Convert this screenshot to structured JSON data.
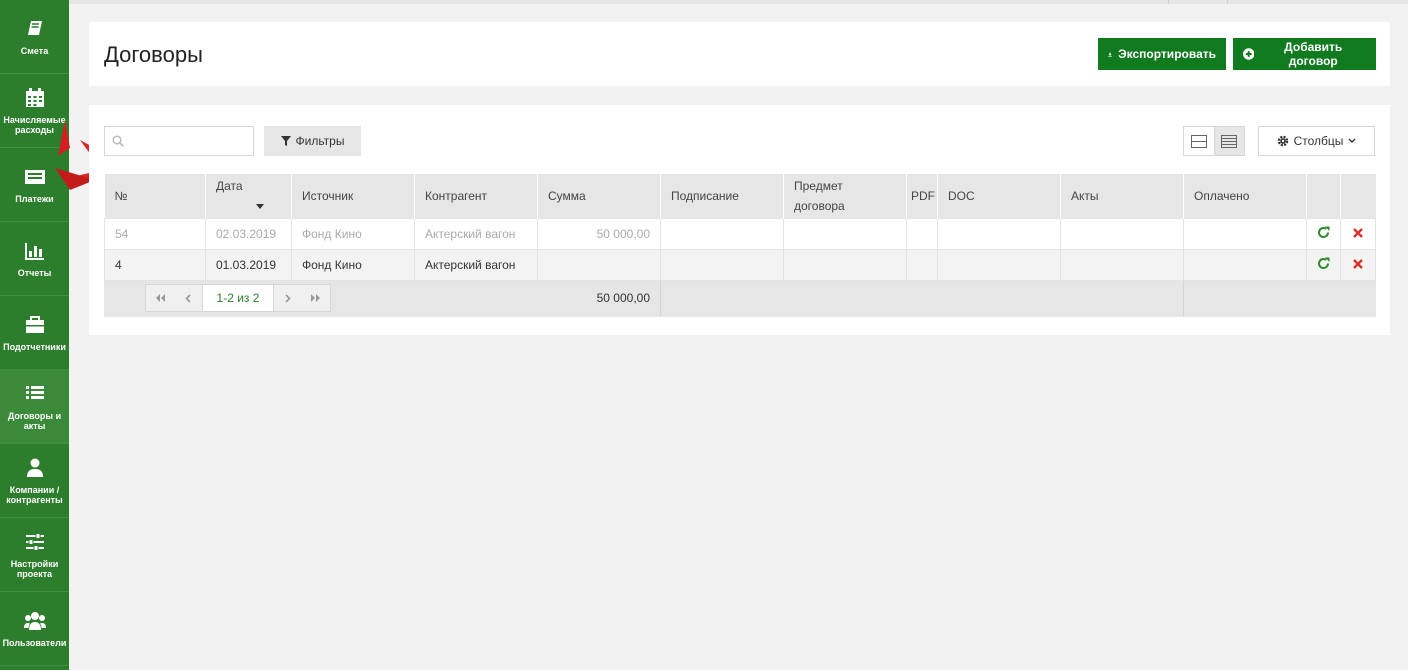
{
  "sidebar": {
    "items": [
      {
        "label": "Смета",
        "icon": "book-icon"
      },
      {
        "label": "Начисляемые расходы",
        "icon": "calendar-icon"
      },
      {
        "label": "Платежи",
        "icon": "money-icon"
      },
      {
        "label": "Отчеты",
        "icon": "bar-chart-icon"
      },
      {
        "label": "Подотчетники",
        "icon": "briefcase-icon"
      },
      {
        "label": "Договоры и акты",
        "icon": "list-icon"
      },
      {
        "label": "Компании / контрагенты",
        "icon": "user-icon"
      },
      {
        "label": "Настройки проекта",
        "icon": "sliders-icon"
      },
      {
        "label": "Пользователи",
        "icon": "users-icon"
      }
    ]
  },
  "header": {
    "title": "Договоры",
    "export_label": "Экспортировать",
    "add_label": "Добавить договор"
  },
  "toolbar": {
    "search_value": "",
    "filter_label": "Фильтры",
    "columns_label": "Столбцы"
  },
  "table": {
    "columns": [
      "№",
      "Дата",
      "Источник",
      "Контрагент",
      "Сумма",
      "Подписание",
      "Предмет договора",
      "PDF",
      "DOC",
      "Акты",
      "Оплачено"
    ],
    "rows": [
      {
        "num": "54",
        "date": "02.03.2019",
        "source": "Фонд Кино",
        "counterparty": "Актерский вагон",
        "sum": "50 000,00",
        "signing": "",
        "subject": "",
        "pdf": "",
        "doc": "",
        "acts": "",
        "paid": ""
      },
      {
        "num": "4",
        "date": "01.03.2019",
        "source": "Фонд Кино",
        "counterparty": "Актерский вагон",
        "sum": "",
        "signing": "",
        "subject": "",
        "pdf": "",
        "doc": "",
        "acts": "",
        "paid": ""
      }
    ],
    "footer": {
      "pager_info": "1-2 из 2",
      "total": "50 000,00"
    }
  },
  "colors": {
    "sidebar_bg": "#2c7d2c",
    "button_green": "#0f7a1e",
    "refresh_green": "#2c8a2c",
    "delete_red": "#d9302c"
  }
}
